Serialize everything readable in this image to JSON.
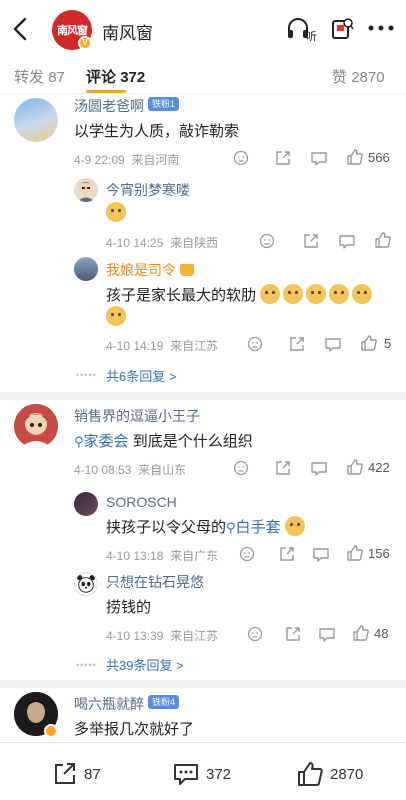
{
  "header": {
    "account_name": "南风窗",
    "logo_text": "南风窗",
    "listen_label": "听"
  },
  "tabs": [
    {
      "label": "转发",
      "count": "87"
    },
    {
      "label": "评论",
      "count": "372"
    },
    {
      "label": "赞",
      "count": "2870"
    }
  ],
  "comments": [
    {
      "user": "汤圆老爸啊",
      "fan_badge": "铁粉1",
      "text": "以学生为人质，敲诈勒索",
      "date": "4-9 22:09",
      "location": "来自河南",
      "likes": "566",
      "replies": [
        {
          "user": "今宵别梦寒喽",
          "date": "4-10 14:25",
          "location": "来自陕西",
          "likes": ""
        },
        {
          "user": "我娘是司令",
          "text": "孩子是家长最大的软肋",
          "date": "4-10 14:19",
          "location": "来自江苏",
          "likes": "5"
        }
      ],
      "more_replies": "共6条回复 >"
    },
    {
      "user": "销售界的逗逼小王子",
      "text_link": "家委会",
      "text": " 到底是个什么组织",
      "date": "4-10 08:53",
      "location": "来自山东",
      "likes": "422",
      "replies": [
        {
          "user": "SOROSCH",
          "text": "挟孩子以令父母的",
          "text_link": "白手套",
          "date": "4-10 13:18",
          "location": "来自广东",
          "likes": "156"
        },
        {
          "user": "只想在钻石晃悠",
          "text": "捞钱的",
          "date": "4-10 13:39",
          "location": "来自江苏",
          "likes": "48"
        }
      ],
      "more_replies": "共39条回复 >"
    },
    {
      "user": "喝六瓶就醉",
      "fan_badge": "铁粉4",
      "text": "多举报几次就好了"
    }
  ],
  "bottom_bar": {
    "reposts": "87",
    "comments": "372",
    "likes": "2870"
  }
}
